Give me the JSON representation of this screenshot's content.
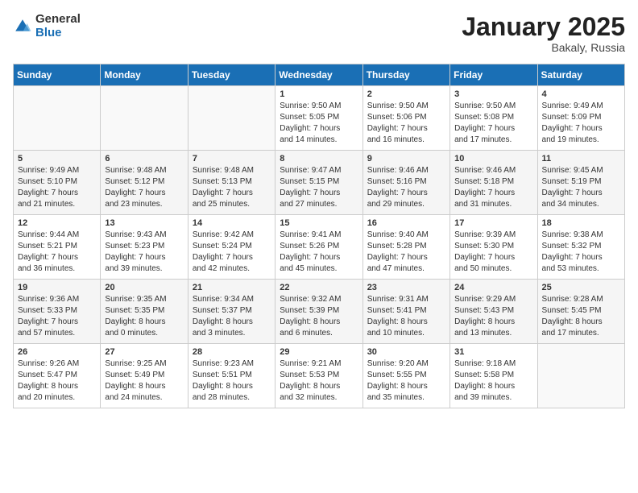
{
  "header": {
    "logo_general": "General",
    "logo_blue": "Blue",
    "month_title": "January 2025",
    "location": "Bakaly, Russia"
  },
  "weekdays": [
    "Sunday",
    "Monday",
    "Tuesday",
    "Wednesday",
    "Thursday",
    "Friday",
    "Saturday"
  ],
  "weeks": [
    [
      {
        "day": "",
        "info": ""
      },
      {
        "day": "",
        "info": ""
      },
      {
        "day": "",
        "info": ""
      },
      {
        "day": "1",
        "info": "Sunrise: 9:50 AM\nSunset: 5:05 PM\nDaylight: 7 hours\nand 14 minutes."
      },
      {
        "day": "2",
        "info": "Sunrise: 9:50 AM\nSunset: 5:06 PM\nDaylight: 7 hours\nand 16 minutes."
      },
      {
        "day": "3",
        "info": "Sunrise: 9:50 AM\nSunset: 5:08 PM\nDaylight: 7 hours\nand 17 minutes."
      },
      {
        "day": "4",
        "info": "Sunrise: 9:49 AM\nSunset: 5:09 PM\nDaylight: 7 hours\nand 19 minutes."
      }
    ],
    [
      {
        "day": "5",
        "info": "Sunrise: 9:49 AM\nSunset: 5:10 PM\nDaylight: 7 hours\nand 21 minutes."
      },
      {
        "day": "6",
        "info": "Sunrise: 9:48 AM\nSunset: 5:12 PM\nDaylight: 7 hours\nand 23 minutes."
      },
      {
        "day": "7",
        "info": "Sunrise: 9:48 AM\nSunset: 5:13 PM\nDaylight: 7 hours\nand 25 minutes."
      },
      {
        "day": "8",
        "info": "Sunrise: 9:47 AM\nSunset: 5:15 PM\nDaylight: 7 hours\nand 27 minutes."
      },
      {
        "day": "9",
        "info": "Sunrise: 9:46 AM\nSunset: 5:16 PM\nDaylight: 7 hours\nand 29 minutes."
      },
      {
        "day": "10",
        "info": "Sunrise: 9:46 AM\nSunset: 5:18 PM\nDaylight: 7 hours\nand 31 minutes."
      },
      {
        "day": "11",
        "info": "Sunrise: 9:45 AM\nSunset: 5:19 PM\nDaylight: 7 hours\nand 34 minutes."
      }
    ],
    [
      {
        "day": "12",
        "info": "Sunrise: 9:44 AM\nSunset: 5:21 PM\nDaylight: 7 hours\nand 36 minutes."
      },
      {
        "day": "13",
        "info": "Sunrise: 9:43 AM\nSunset: 5:23 PM\nDaylight: 7 hours\nand 39 minutes."
      },
      {
        "day": "14",
        "info": "Sunrise: 9:42 AM\nSunset: 5:24 PM\nDaylight: 7 hours\nand 42 minutes."
      },
      {
        "day": "15",
        "info": "Sunrise: 9:41 AM\nSunset: 5:26 PM\nDaylight: 7 hours\nand 45 minutes."
      },
      {
        "day": "16",
        "info": "Sunrise: 9:40 AM\nSunset: 5:28 PM\nDaylight: 7 hours\nand 47 minutes."
      },
      {
        "day": "17",
        "info": "Sunrise: 9:39 AM\nSunset: 5:30 PM\nDaylight: 7 hours\nand 50 minutes."
      },
      {
        "day": "18",
        "info": "Sunrise: 9:38 AM\nSunset: 5:32 PM\nDaylight: 7 hours\nand 53 minutes."
      }
    ],
    [
      {
        "day": "19",
        "info": "Sunrise: 9:36 AM\nSunset: 5:33 PM\nDaylight: 7 hours\nand 57 minutes."
      },
      {
        "day": "20",
        "info": "Sunrise: 9:35 AM\nSunset: 5:35 PM\nDaylight: 8 hours\nand 0 minutes."
      },
      {
        "day": "21",
        "info": "Sunrise: 9:34 AM\nSunset: 5:37 PM\nDaylight: 8 hours\nand 3 minutes."
      },
      {
        "day": "22",
        "info": "Sunrise: 9:32 AM\nSunset: 5:39 PM\nDaylight: 8 hours\nand 6 minutes."
      },
      {
        "day": "23",
        "info": "Sunrise: 9:31 AM\nSunset: 5:41 PM\nDaylight: 8 hours\nand 10 minutes."
      },
      {
        "day": "24",
        "info": "Sunrise: 9:29 AM\nSunset: 5:43 PM\nDaylight: 8 hours\nand 13 minutes."
      },
      {
        "day": "25",
        "info": "Sunrise: 9:28 AM\nSunset: 5:45 PM\nDaylight: 8 hours\nand 17 minutes."
      }
    ],
    [
      {
        "day": "26",
        "info": "Sunrise: 9:26 AM\nSunset: 5:47 PM\nDaylight: 8 hours\nand 20 minutes."
      },
      {
        "day": "27",
        "info": "Sunrise: 9:25 AM\nSunset: 5:49 PM\nDaylight: 8 hours\nand 24 minutes."
      },
      {
        "day": "28",
        "info": "Sunrise: 9:23 AM\nSunset: 5:51 PM\nDaylight: 8 hours\nand 28 minutes."
      },
      {
        "day": "29",
        "info": "Sunrise: 9:21 AM\nSunset: 5:53 PM\nDaylight: 8 hours\nand 32 minutes."
      },
      {
        "day": "30",
        "info": "Sunrise: 9:20 AM\nSunset: 5:55 PM\nDaylight: 8 hours\nand 35 minutes."
      },
      {
        "day": "31",
        "info": "Sunrise: 9:18 AM\nSunset: 5:58 PM\nDaylight: 8 hours\nand 39 minutes."
      },
      {
        "day": "",
        "info": ""
      }
    ]
  ]
}
